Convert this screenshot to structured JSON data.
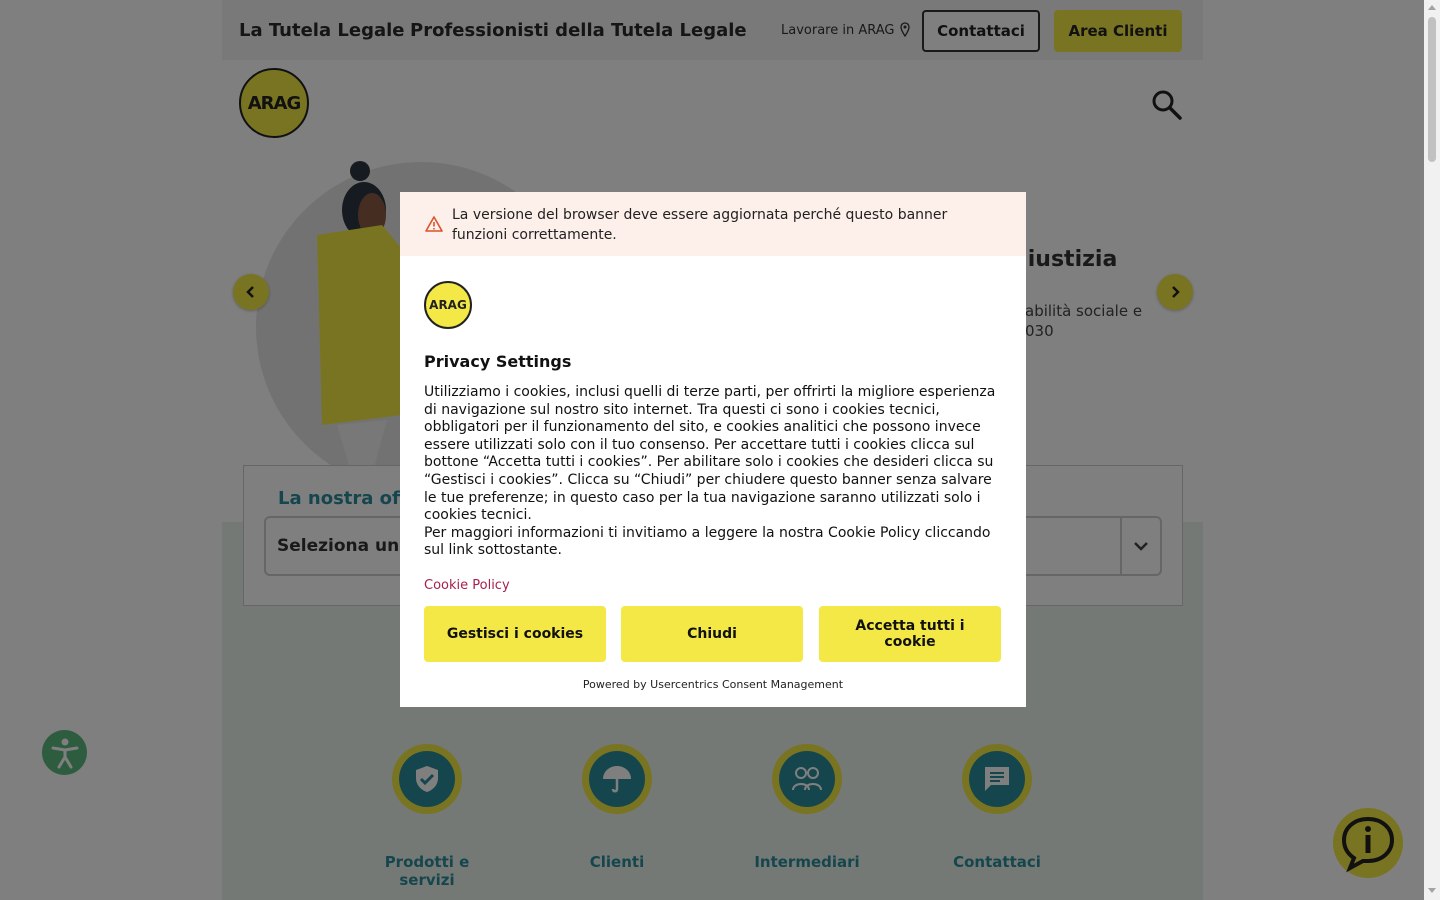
{
  "topbar": {
    "title1": "La Tutela Legale",
    "title2": "Professionisti della Tutela Legale",
    "work_link": "Lavorare in ARAG",
    "contact_button": "Contattaci",
    "client_area_button": "Area Clienti"
  },
  "header": {
    "logo_text": "ARAG"
  },
  "hero": {
    "title_fragment": "giustizia",
    "subtitle_line1": "abilità sociale e",
    "subtitle_line2": "030"
  },
  "offer": {
    "title": "La nostra off",
    "select_text": "Seleziona un p"
  },
  "categories": [
    {
      "label": "Prodotti e servizi",
      "icon": "shield-check-icon"
    },
    {
      "label": "Clienti",
      "icon": "umbrella-icon"
    },
    {
      "label": "Intermediari",
      "icon": "people-icon"
    },
    {
      "label": "Contattaci",
      "icon": "chat-icon"
    }
  ],
  "modal": {
    "warning_text": "La versione del browser deve essere aggiornata perché questo banner funzioni correttamente.",
    "logo_text": "ARAG",
    "title": "Privacy Settings",
    "body_paragraph1": "Utilizziamo i cookies, inclusi quelli di terze parti, per offrirti la migliore esperienza di navigazione sul nostro sito internet. Tra questi ci sono i cookies tecnici, obbligatori per il funzionamento del sito, e cookies analitici che possono invece essere utilizzati solo con il tuo consenso. Per accettare tutti i cookies clicca sul bottone “Accetta tutti i cookies”. Per abilitare solo i cookies che desideri clicca su “Gestisci i cookies”. Clicca su “Chiudi” per chiudere questo banner senza salvare le tue preferenze; in questo caso per la tua navigazione saranno utilizzati solo i cookies tecnici.",
    "body_paragraph2": "Per maggiori informazioni ti invitiamo a leggere la nostra Cookie Policy cliccando sul link sottostante.",
    "cookie_policy_link": "Cookie Policy",
    "manage_button": "Gestisci i cookies",
    "close_button": "Chiudi",
    "accept_button": "Accetta tutti i cookie",
    "powered_by": "Powered by Usercentrics Consent Management"
  },
  "colors": {
    "brand_yellow": "#f3e845",
    "teal": "#2d8d9a",
    "link": "#a6224b",
    "warning_bg": "#fdf0ea"
  }
}
